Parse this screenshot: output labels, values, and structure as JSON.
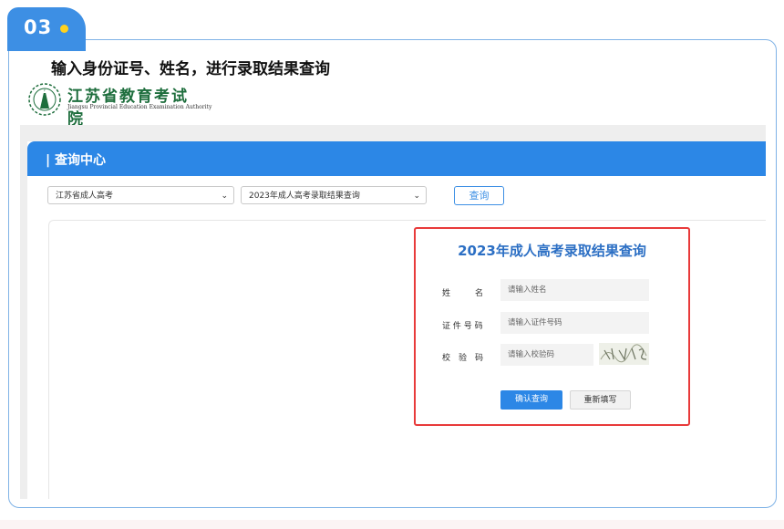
{
  "step": {
    "number": "03"
  },
  "headline": "输入身份证号、姓名，进行录取结果查询",
  "logo": {
    "title": "江苏省教育考试院",
    "subtitle": "Jiangsu Provincial Education Examination Authority"
  },
  "header": {
    "title": "| 查询中心"
  },
  "filters": {
    "category": "江苏省成人高考",
    "query_type": "2023年成人高考录取结果查询",
    "query_label": "查询"
  },
  "form": {
    "title": "2023年成人高考录取结果查询",
    "name_label": "姓　　　名",
    "name_placeholder": "请输入姓名",
    "id_label": "证 件 号 码",
    "id_placeholder": "请输入证件号码",
    "captcha_label": "校　验　码",
    "captcha_placeholder": "请输入校验码",
    "confirm_label": "确认查询",
    "reset_label": "重新填写"
  },
  "colors": {
    "accent": "#2c87e6",
    "step_tab": "#3d8fe4",
    "highlight_border": "#e83a3a",
    "logo_green": "#1e6e3d"
  }
}
